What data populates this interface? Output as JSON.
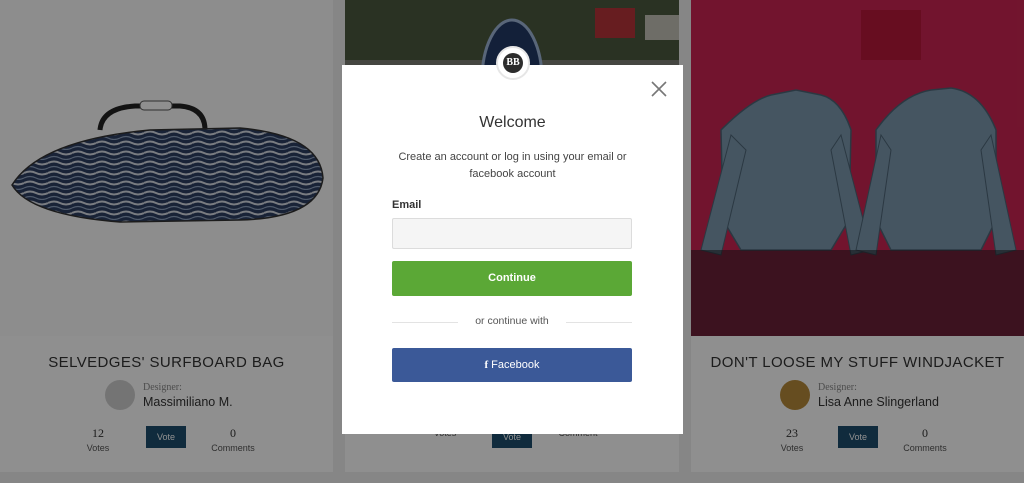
{
  "cards": [
    {
      "title": "SELVEDGES' SURFBOARD BAG",
      "designer_role": "Designer:",
      "designer_name": "Massimiliano M.",
      "votes": "12",
      "votes_label": "Votes",
      "vote_button": "Vote",
      "comments": "0",
      "comments_label": "Comments"
    },
    {
      "title": "",
      "designer_role": "",
      "designer_name": "",
      "votes": "",
      "votes_label": "Votes",
      "vote_button": "Vote",
      "comments": "",
      "comments_label": "Comment"
    },
    {
      "title": "DON'T LOOSE MY STUFF WINDJACKET",
      "designer_role": "Designer:",
      "designer_name": "Lisa Anne Slingerland",
      "votes": "23",
      "votes_label": "Votes",
      "vote_button": "Vote",
      "comments": "0",
      "comments_label": "Comments"
    }
  ],
  "modal": {
    "logo_text": "BB",
    "title": "Welcome",
    "description": "Create an account or log in using your email or facebook account",
    "email_label": "Email",
    "email_value": "",
    "email_placeholder": "",
    "continue_button": "Continue",
    "divider_text": "or continue with",
    "facebook_icon": "f",
    "facebook_button": "Facebook",
    "close_icon": "close-icon"
  },
  "colors": {
    "overlay": "rgba(0,0,0,0.44)",
    "continue_green": "#5ba836",
    "facebook_blue": "#3b5998",
    "vote_blue": "#1d4e6e"
  }
}
